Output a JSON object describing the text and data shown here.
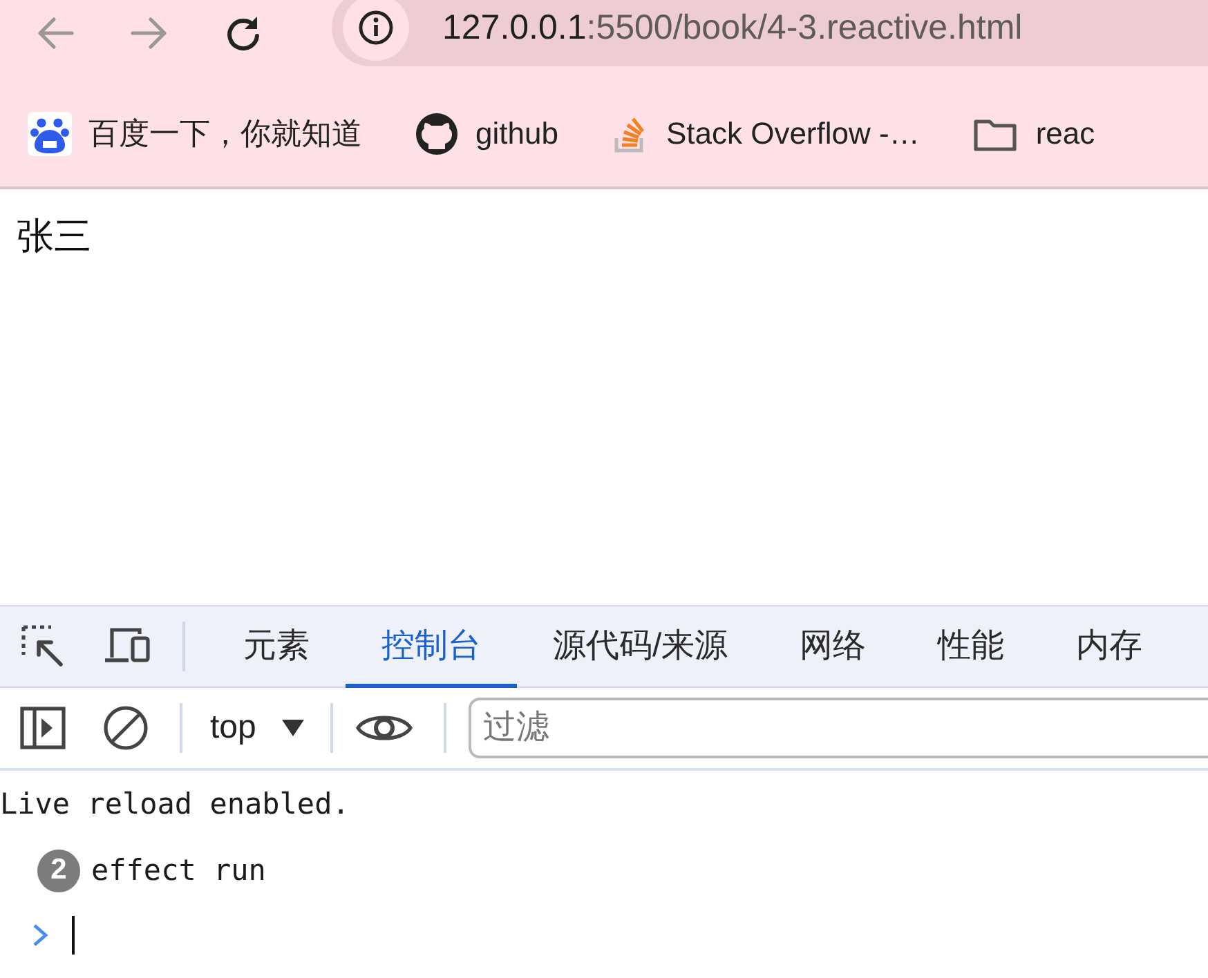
{
  "browser": {
    "nav_buttons": [
      {
        "kind": "back",
        "disabled": true
      },
      {
        "kind": "forward",
        "disabled": true
      },
      {
        "kind": "reload",
        "disabled": false
      }
    ],
    "address": {
      "host": "127.0.0.1",
      "path": ":5500/book/4-3.reactive.html"
    },
    "bookmarks": [
      {
        "kind": "paw",
        "label": "百度一下，你就知道"
      },
      {
        "kind": "cat",
        "label": "github"
      },
      {
        "kind": "stack",
        "label": "Stack Overflow -…"
      },
      {
        "kind": "folder",
        "label": "reac"
      }
    ]
  },
  "page": {
    "text": "张三"
  },
  "devtools": {
    "tabs": [
      {
        "label": "元素",
        "selected": false
      },
      {
        "label": "控制台",
        "selected": true
      },
      {
        "label": "源代码/来源",
        "selected": false
      },
      {
        "label": "网络",
        "selected": false
      },
      {
        "label": "性能",
        "selected": false
      },
      {
        "label": "内存",
        "selected": false
      }
    ],
    "toolbar": {
      "context": "top",
      "filter": {
        "placeholder": "过滤"
      }
    },
    "messages": [
      {
        "kind": "info",
        "text": "Live reload enabled."
      },
      {
        "kind": "repeat",
        "count": "2",
        "text": "effect run"
      }
    ]
  }
}
